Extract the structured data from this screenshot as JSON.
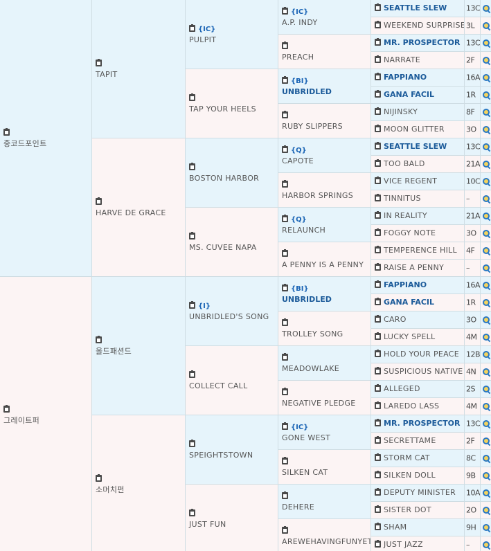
{
  "gen1": [
    {
      "name": "중코드포인트"
    },
    {
      "name": "그레이트퍼"
    }
  ],
  "gen2": [
    {
      "name": "TAPIT"
    },
    {
      "name": "HARVE DE GRACE"
    },
    {
      "name": "올드패션드"
    },
    {
      "name": "소머치펀"
    }
  ],
  "gen3": [
    {
      "code": "{IC}",
      "name": "PULPIT"
    },
    {
      "code": "",
      "name": "TAP YOUR HEELS"
    },
    {
      "code": "",
      "name": "BOSTON HARBOR"
    },
    {
      "code": "",
      "name": "MS. CUVEE NAPA"
    },
    {
      "code": "{I}",
      "name": "UNBRIDLED'S SONG"
    },
    {
      "code": "",
      "name": "COLLECT CALL"
    },
    {
      "code": "",
      "name": "SPEIGHTSTOWN"
    },
    {
      "code": "",
      "name": "JUST FUN"
    }
  ],
  "gen4": [
    {
      "code": "{IC}",
      "name": "A.P. INDY",
      "bold": false
    },
    {
      "code": "",
      "name": "PREACH",
      "bold": false
    },
    {
      "code": "{BI}",
      "name": "UNBRIDLED",
      "bold": true
    },
    {
      "code": "",
      "name": "RUBY SLIPPERS",
      "bold": false
    },
    {
      "code": "{Q}",
      "name": "CAPOTE",
      "bold": false
    },
    {
      "code": "",
      "name": "HARBOR SPRINGS",
      "bold": false
    },
    {
      "code": "{Q}",
      "name": "RELAUNCH",
      "bold": false
    },
    {
      "code": "",
      "name": "A PENNY IS A PENNY",
      "bold": false
    },
    {
      "code": "{BI}",
      "name": "UNBRIDLED",
      "bold": true
    },
    {
      "code": "",
      "name": "TROLLEY SONG",
      "bold": false
    },
    {
      "code": "",
      "name": "MEADOWLAKE",
      "bold": false
    },
    {
      "code": "",
      "name": "NEGATIVE PLEDGE",
      "bold": false
    },
    {
      "code": "{IC}",
      "name": "GONE WEST",
      "bold": false
    },
    {
      "code": "",
      "name": "SILKEN CAT",
      "bold": false
    },
    {
      "code": "",
      "name": "DEHERE",
      "bold": false
    },
    {
      "code": "",
      "name": "AREWEHAVINGFUNYET",
      "bold": false
    }
  ],
  "gen5": [
    {
      "name": "SEATTLE SLEW",
      "bold": true,
      "num": "13C"
    },
    {
      "name": "WEEKEND SURPRISE",
      "bold": false,
      "num": "3L"
    },
    {
      "name": "MR. PROSPECTOR",
      "bold": true,
      "num": "13C"
    },
    {
      "name": "NARRATE",
      "bold": false,
      "num": "2F"
    },
    {
      "name": "FAPPIANO",
      "bold": true,
      "num": "16A"
    },
    {
      "name": "GANA FACIL",
      "bold": true,
      "num": "1R"
    },
    {
      "name": "NIJINSKY",
      "bold": false,
      "num": "8F"
    },
    {
      "name": "MOON GLITTER",
      "bold": false,
      "num": "3O"
    },
    {
      "name": "SEATTLE SLEW",
      "bold": true,
      "num": "13C"
    },
    {
      "name": "TOO BALD",
      "bold": false,
      "num": "21A"
    },
    {
      "name": "VICE REGENT",
      "bold": false,
      "num": "10C"
    },
    {
      "name": "TINNITUS",
      "bold": false,
      "num": "–"
    },
    {
      "name": "IN REALITY",
      "bold": false,
      "num": "21A"
    },
    {
      "name": "FOGGY NOTE",
      "bold": false,
      "num": "3O"
    },
    {
      "name": "TEMPERENCE HILL",
      "bold": false,
      "num": "4F"
    },
    {
      "name": "RAISE A PENNY",
      "bold": false,
      "num": "–"
    },
    {
      "name": "FAPPIANO",
      "bold": true,
      "num": "16A"
    },
    {
      "name": "GANA FACIL",
      "bold": true,
      "num": "1R"
    },
    {
      "name": "CARO",
      "bold": false,
      "num": "3O"
    },
    {
      "name": "LUCKY SPELL",
      "bold": false,
      "num": "4M"
    },
    {
      "name": "HOLD YOUR PEACE",
      "bold": false,
      "num": "12B"
    },
    {
      "name": "SUSPICIOUS NATIVE",
      "bold": false,
      "num": "4N"
    },
    {
      "name": "ALLEGED",
      "bold": false,
      "num": "2S"
    },
    {
      "name": "LAREDO LASS",
      "bold": false,
      "num": "4M"
    },
    {
      "name": "MR. PROSPECTOR",
      "bold": true,
      "num": "13C"
    },
    {
      "name": "SECRETTAME",
      "bold": false,
      "num": "2F"
    },
    {
      "name": "STORM CAT",
      "bold": false,
      "num": "8C"
    },
    {
      "name": "SILKEN DOLL",
      "bold": false,
      "num": "9B"
    },
    {
      "name": "DEPUTY MINISTER",
      "bold": false,
      "num": "10A"
    },
    {
      "name": "SISTER DOT",
      "bold": false,
      "num": "2O"
    },
    {
      "name": "SHAM",
      "bold": false,
      "num": "9H"
    },
    {
      "name": "JUST JAZZ",
      "bold": false,
      "num": "–"
    }
  ],
  "icons": {
    "clipboard": "clipboard-icon",
    "search": "magnifier-search-icon"
  },
  "colors": {
    "blue_cell": "#e6f4fb",
    "pink_cell": "#fcf4f4",
    "link_blue": "#1c5b9a",
    "border": "#cfdde3"
  }
}
